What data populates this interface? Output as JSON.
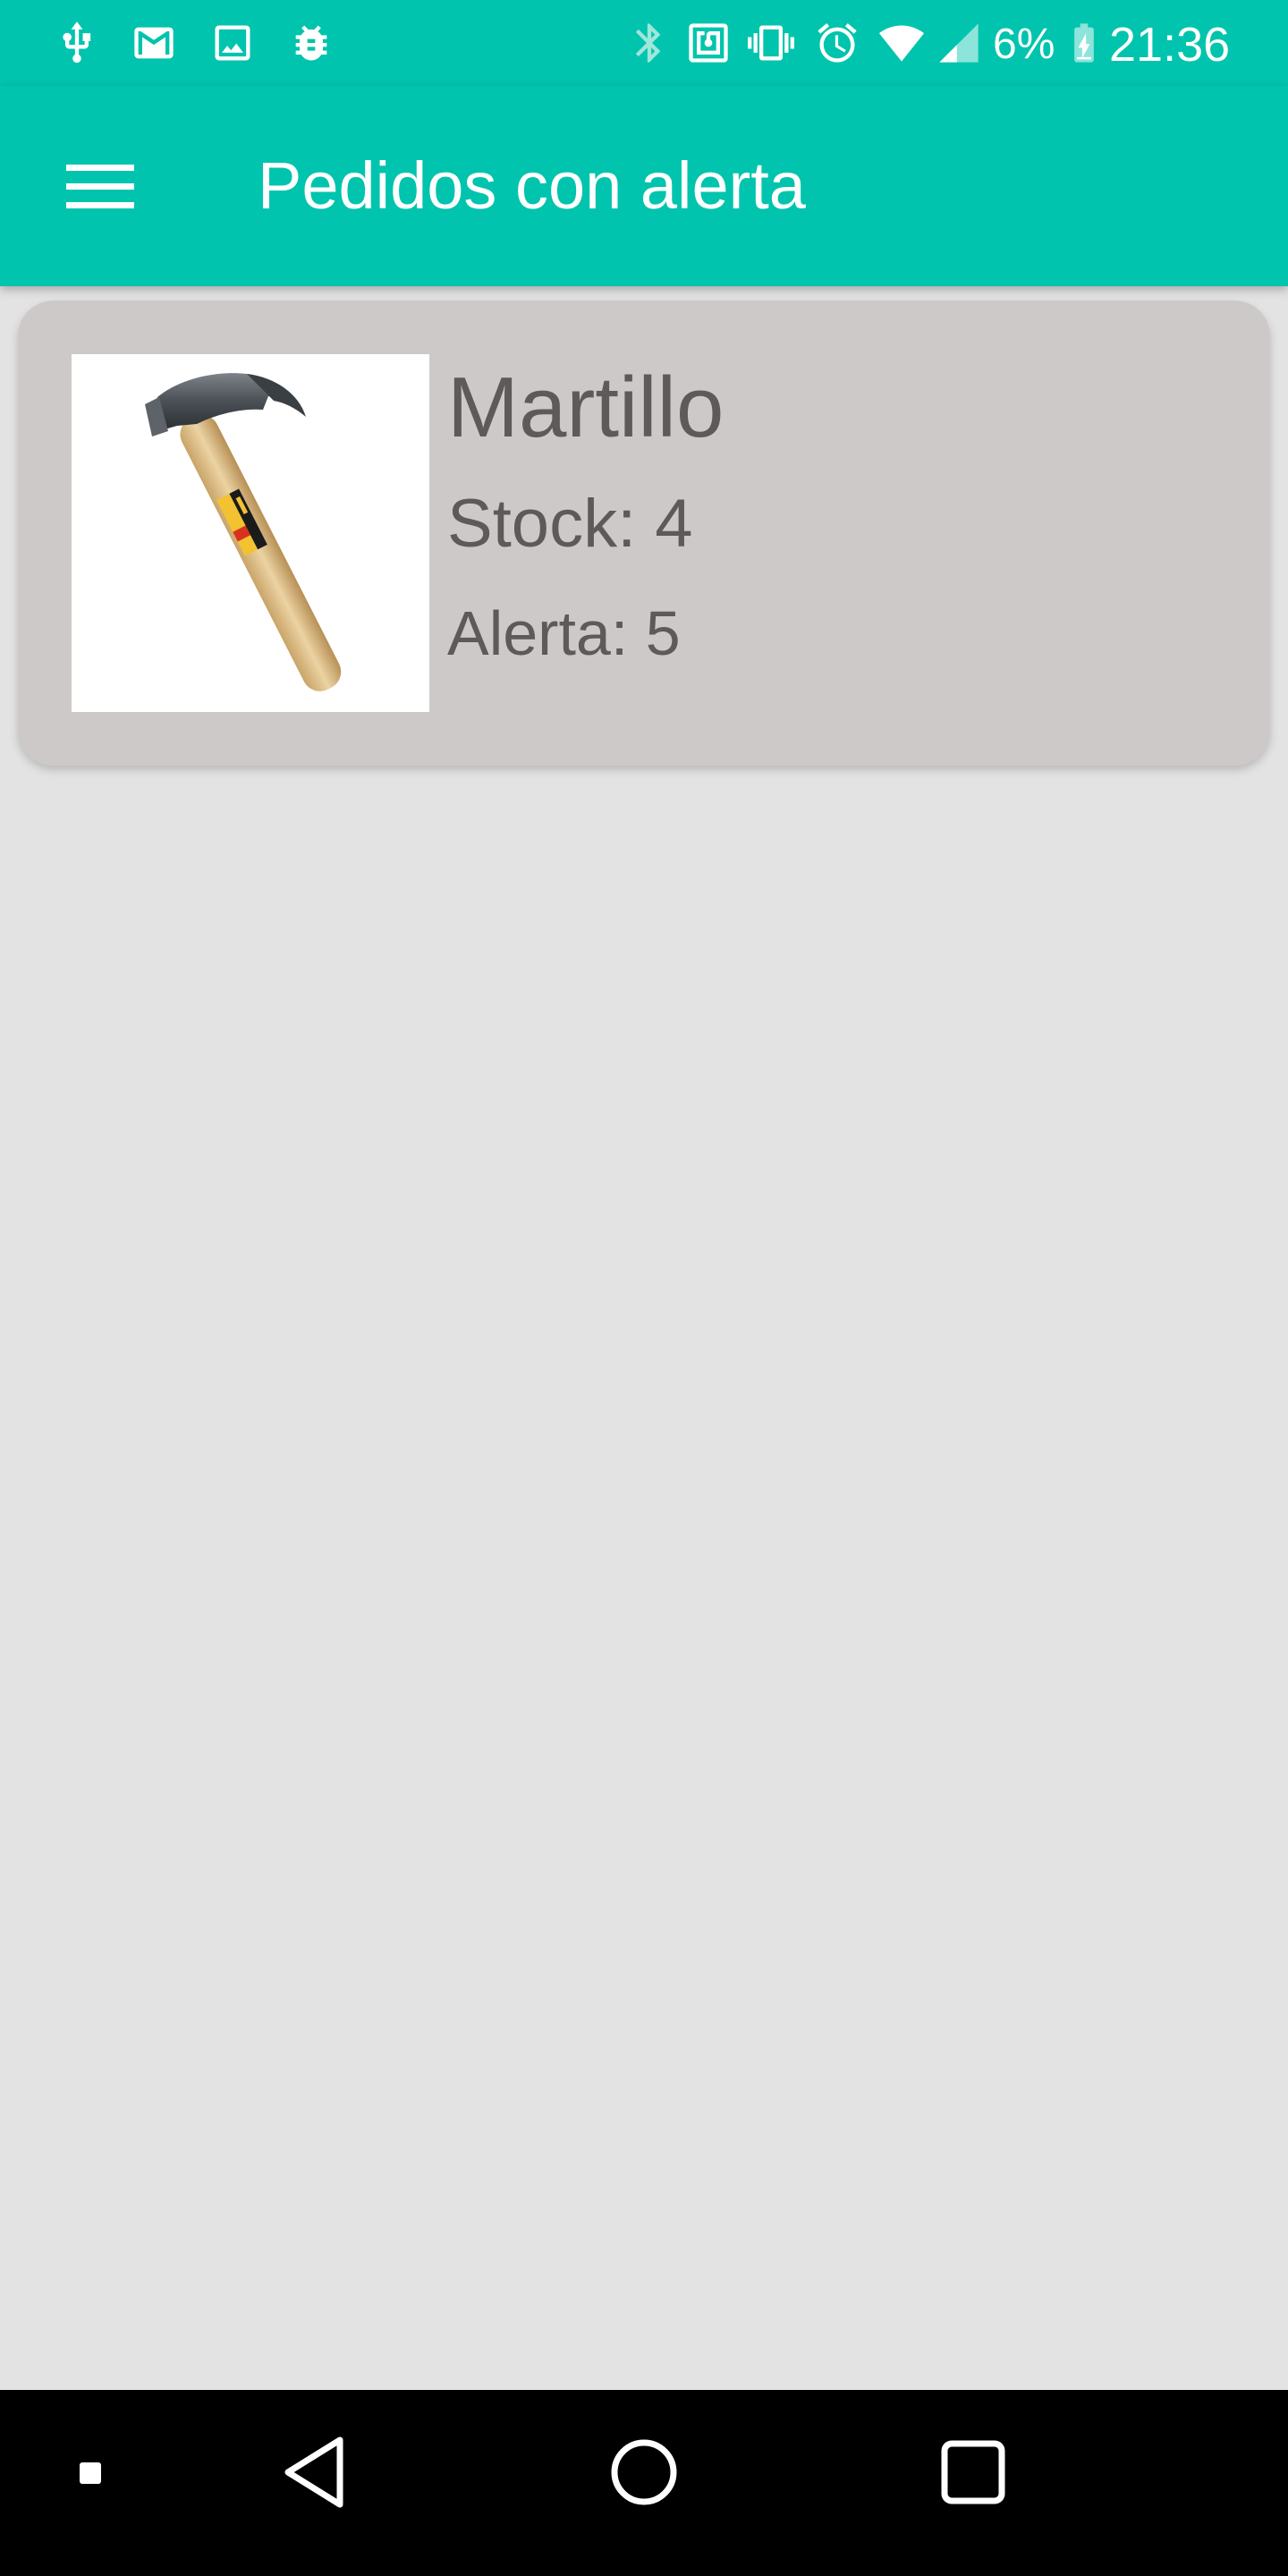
{
  "status_bar": {
    "battery_percent": "6%",
    "time": "21:36",
    "left_icons": [
      "usb-icon",
      "gmail-icon",
      "gallery-icon",
      "android-debug-icon"
    ],
    "right_icons": [
      "bluetooth-icon",
      "nfc-icon",
      "vibrate-icon",
      "alarm-icon",
      "wifi-icon",
      "signal-icon",
      "battery-charging-icon"
    ],
    "battery_level": 0.06
  },
  "app_bar": {
    "title": "Pedidos con alerta",
    "menu_icon": "hamburger-menu-icon"
  },
  "products": [
    {
      "name": "Martillo",
      "stock_text": "Stock: 4",
      "alert_text": "Alerta: 5",
      "image_icon": "hammer-image"
    }
  ],
  "nav_bar": {
    "buttons": [
      "small-square-icon",
      "back-icon",
      "home-icon",
      "recents-icon"
    ]
  },
  "colors": {
    "primary": "#00c4ad",
    "background": "#e3e3e3",
    "card": "#cdc9c9",
    "card_text": "#5e5a5a",
    "nav_bar": "#000000"
  }
}
